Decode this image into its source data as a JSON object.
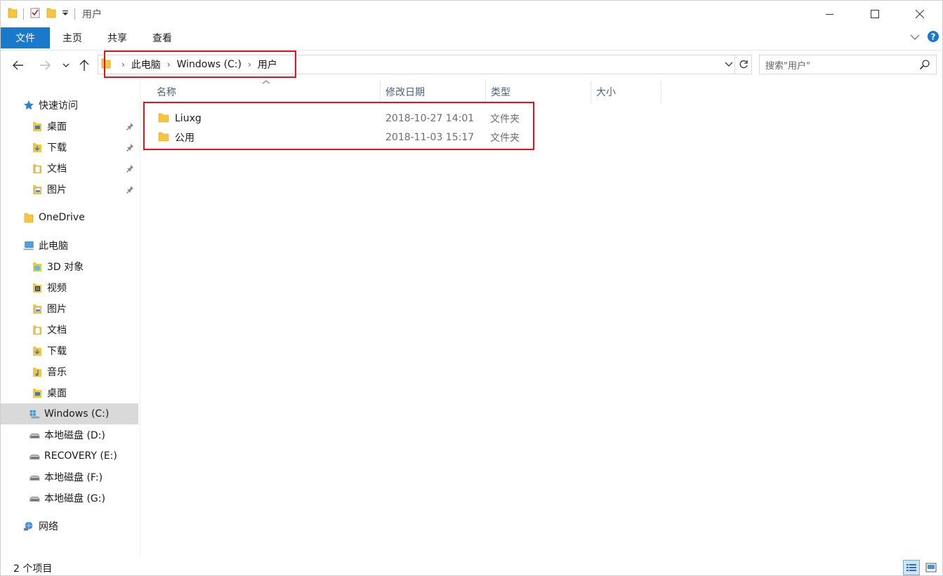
{
  "window": {
    "title": "用户"
  },
  "ribbon": {
    "tabs": [
      "文件",
      "主页",
      "共享",
      "查看"
    ]
  },
  "address": {
    "crumbs": [
      "此电脑",
      "Windows (C:)",
      "用户"
    ]
  },
  "search": {
    "placeholder": "搜索\"用户\""
  },
  "sidebar": {
    "items": [
      {
        "label": "快速访问",
        "icon": "star-icon",
        "pinned": false
      },
      {
        "label": "桌面",
        "icon": "desktop-folder-icon",
        "pinned": true
      },
      {
        "label": "下载",
        "icon": "download-folder-icon",
        "pinned": true
      },
      {
        "label": "文档",
        "icon": "documents-folder-icon",
        "pinned": true
      },
      {
        "label": "图片",
        "icon": "pictures-folder-icon",
        "pinned": true
      },
      {
        "label": "OneDrive",
        "icon": "folder-icon",
        "pinned": false
      },
      {
        "label": "此电脑",
        "icon": "computer-icon",
        "pinned": false
      },
      {
        "label": "3D 对象",
        "icon": "3d-objects-icon",
        "pinned": false
      },
      {
        "label": "视频",
        "icon": "videos-folder-icon",
        "pinned": false
      },
      {
        "label": "图片",
        "icon": "pictures-folder-icon",
        "pinned": false
      },
      {
        "label": "文档",
        "icon": "documents-folder-icon",
        "pinned": false
      },
      {
        "label": "下载",
        "icon": "download-folder-icon",
        "pinned": false
      },
      {
        "label": "音乐",
        "icon": "music-folder-icon",
        "pinned": false
      },
      {
        "label": "桌面",
        "icon": "desktop-folder-icon",
        "pinned": false
      },
      {
        "label": "Windows (C:)",
        "icon": "windows-drive-icon",
        "pinned": false,
        "selected": true
      },
      {
        "label": "本地磁盘 (D:)",
        "icon": "drive-icon",
        "pinned": false
      },
      {
        "label": "RECOVERY (E:)",
        "icon": "drive-icon",
        "pinned": false
      },
      {
        "label": "本地磁盘 (F:)",
        "icon": "drive-icon",
        "pinned": false
      },
      {
        "label": "本地磁盘 (G:)",
        "icon": "drive-icon",
        "pinned": false
      },
      {
        "label": "网络",
        "icon": "network-icon",
        "pinned": false
      }
    ]
  },
  "columns": {
    "name": "名称",
    "modified": "修改日期",
    "type": "类型",
    "size": "大小"
  },
  "files": [
    {
      "name": "Liuxg",
      "modified": "2018-10-27 14:01",
      "type": "文件夹"
    },
    {
      "name": "公用",
      "modified": "2018-11-03 15:17",
      "type": "文件夹"
    }
  ],
  "status": {
    "count_text": "2 个项目"
  },
  "colors": {
    "accent": "#1979ca",
    "highlight_box": "#e0131f",
    "selected_bg": "#d9d9d9",
    "folder_yellow": "#f4c542"
  }
}
